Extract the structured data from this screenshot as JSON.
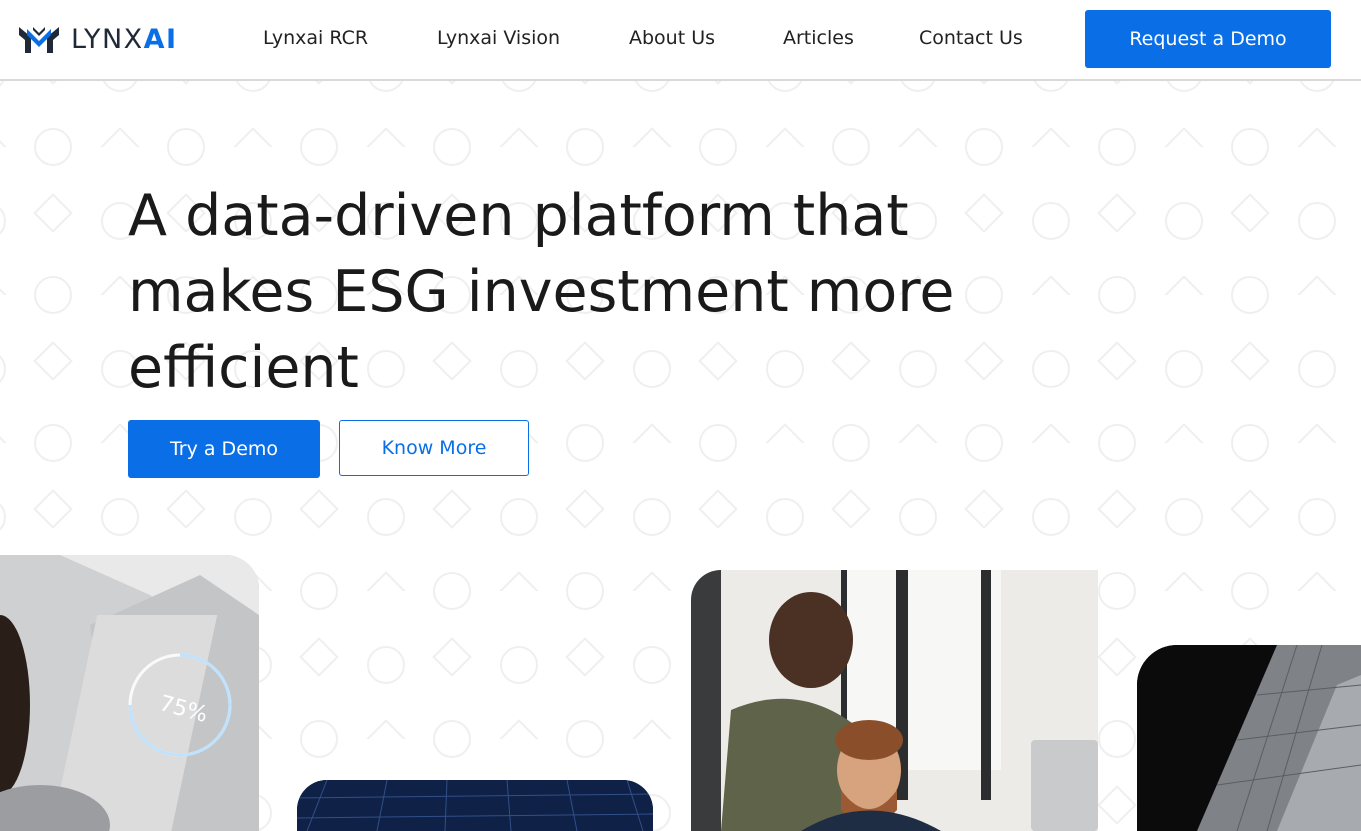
{
  "header": {
    "logo": {
      "text_main": "LYNX",
      "text_accent": "AI",
      "icon": "lynxai-logo-icon"
    },
    "nav": [
      {
        "label": "Lynxai RCR"
      },
      {
        "label": "Lynxai Vision"
      },
      {
        "label": "About Us"
      },
      {
        "label": "Articles"
      },
      {
        "label": "Contact Us"
      }
    ],
    "cta_label": "Request a Demo"
  },
  "hero": {
    "title_lines": [
      "A data-driven platform that",
      "makes ESG investment more",
      "efficient"
    ],
    "primary_button": "Try a Demo",
    "secondary_button": "Know More"
  },
  "images": [
    {
      "name": "woman-holographic-gauge-photo",
      "gauge_label": "75%"
    },
    {
      "name": "dark-blue-data-grid-photo"
    },
    {
      "name": "colleagues-laughing-office-photo"
    },
    {
      "name": "skyscraper-glass-photo"
    }
  ],
  "colors": {
    "accent": "#0a6fe6",
    "text": "#1a1a1a",
    "pattern": "#f2f2f2",
    "header_border": "#d9d9d9"
  }
}
